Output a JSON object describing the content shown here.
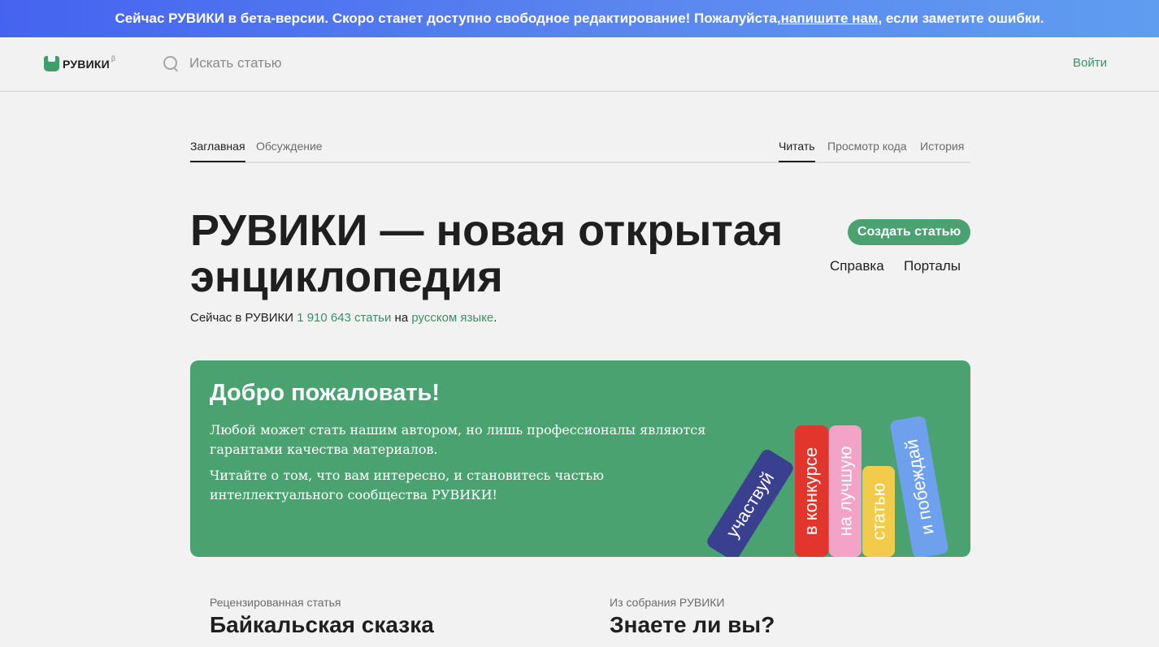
{
  "banner": {
    "text_before": "Сейчас РУВИКИ в бета-версии. Скоро станет доступно свободное редактирование! Пожалуйста, ",
    "link": "напишите нам",
    "text_after": ", если заметите ошибки."
  },
  "header": {
    "logo_text": "РУВИКИ",
    "logo_beta": "β",
    "search_placeholder": "Искать статью",
    "login": "Войти"
  },
  "tabs": {
    "left": [
      "Заглавная",
      "Обсуждение"
    ],
    "right": [
      "Читать",
      "Просмотр кода",
      "История"
    ]
  },
  "main": {
    "title": "РУВИКИ — новая открытая энциклопедия",
    "stats_prefix": "Сейчас в РУВИКИ ",
    "stats_count": "1 910 643 статьи",
    "stats_middle": " на ",
    "stats_lang": "русском языке",
    "stats_suffix": ".",
    "create_button": "Создать статью",
    "help": "Справка",
    "portals": "Порталы"
  },
  "welcome": {
    "title": "Добро пожаловать!",
    "p1": "Любой может стать нашим автором, но лишь профессионалы являются гарантами качества материалов.",
    "p2": "Читайте о том, что вам интересно, и становитесь частью интеллектуального сообщества РУВИКИ!",
    "books": [
      {
        "label": "участвуй",
        "color": "#3b3f8f"
      },
      {
        "label": "в конкурсе",
        "color": "#e2362c"
      },
      {
        "label": "на лучшую",
        "color": "#f2a3c6"
      },
      {
        "label": "статью",
        "color": "#f2cb4a"
      },
      {
        "label": "и побеждай",
        "color": "#6fa0ee"
      }
    ]
  },
  "sections": {
    "left_kicker": "Рецензированная статья",
    "left_title": "Байкальская сказка",
    "right_kicker": "Из собрания РУВИКИ",
    "right_title": "Знаете ли вы?"
  }
}
